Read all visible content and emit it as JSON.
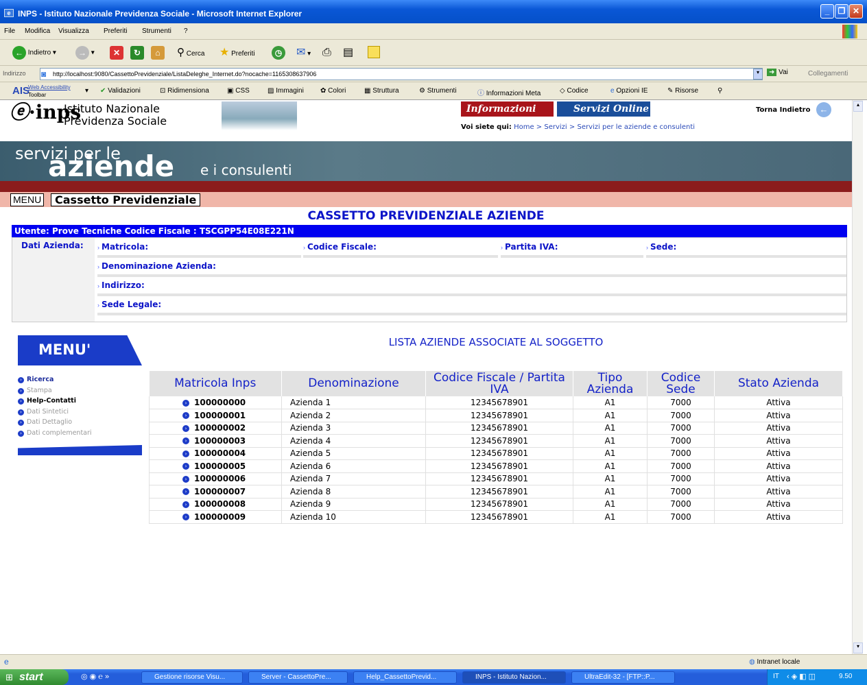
{
  "window": {
    "title": "INPS - Istituto Nazionale Previdenza Sociale - Microsoft Internet Explorer"
  },
  "menubar": [
    "File",
    "Modifica",
    "Visualizza",
    "Preferiti",
    "Strumenti",
    "?"
  ],
  "toolbar": {
    "back": "Indietro",
    "search": "Cerca",
    "favorites": "Preferiti"
  },
  "addressbar": {
    "label": "Indirizzo",
    "url": "http://localhost:9080/CassettoPrevidenziale/ListaDeleghe_Internet.do?nocache=1165308637906",
    "go": "Vai",
    "links": "Collegamenti"
  },
  "aisbar": {
    "logo": "AIS",
    "web_acc": "Web Accessibility",
    "toolbar": "Toolbar",
    "items": [
      "Validazioni",
      "Ridimensiona",
      "CSS",
      "Immagini",
      "Colori",
      "Struttura",
      "Strumenti",
      "Informazioni Meta",
      "Codice",
      "Opzioni IE",
      "Risorse"
    ]
  },
  "header": {
    "logo": "e-inps",
    "org_line1": "Istituto Nazionale",
    "org_line2": "Previdenza Sociale",
    "tab_info": "Informazioni",
    "tab_servizi": "Servizi Online",
    "back": "Torna Indietro",
    "breadcrumb_label": "Voi siete qui:",
    "breadcrumb": [
      "Home",
      ">",
      "Servizi",
      ">",
      "Servizi per le aziende e consulenti"
    ]
  },
  "banner": {
    "line1": "servizi per le",
    "line2": "aziende",
    "line3": "e i consulenti"
  },
  "menuline": {
    "menu": "MENU",
    "section": "Cassetto Previdenziale"
  },
  "main": {
    "title": "CASSETTO PREVIDENZIALE AZIENDE",
    "user": "Utente:  Prove Tecniche    Codice Fiscale :  TSCGPP54E08E221N"
  },
  "dati": {
    "label": "Dati Azienda:",
    "matricola": "Matricola:",
    "cf": "Codice Fiscale:",
    "piva": "Partita IVA:",
    "sede": "Sede:",
    "denominazione": "Denominazione Azienda:",
    "indirizzo": "Indirizzo:",
    "sede_legale": "Sede Legale:"
  },
  "sidemenu": {
    "title": "MENU'",
    "items": [
      {
        "label": "Ricerca",
        "bold": true
      },
      {
        "label": "Stampa",
        "bold": false
      },
      {
        "label": "Help-Contatti",
        "bold": true
      },
      {
        "label": "Dati Sintetici",
        "bold": false
      },
      {
        "label": "Dati Dettaglio",
        "bold": false
      },
      {
        "label": "Dati complementari",
        "bold": false
      }
    ]
  },
  "list": {
    "title": "LISTA AZIENDE ASSOCIATE AL SOGGETTO",
    "headers": [
      "Matricola Inps",
      "Denominazione",
      "Codice Fiscale / Partita IVA",
      "Tipo Azienda",
      "Codice Sede",
      "Stato Azienda"
    ],
    "rows": [
      [
        "100000000",
        "Azienda 1",
        "12345678901",
        "A1",
        "7000",
        "Attiva"
      ],
      [
        "100000001",
        "Azienda 2",
        "12345678901",
        "A1",
        "7000",
        "Attiva"
      ],
      [
        "100000002",
        "Azienda 3",
        "12345678901",
        "A1",
        "7000",
        "Attiva"
      ],
      [
        "100000003",
        "Azienda 4",
        "12345678901",
        "A1",
        "7000",
        "Attiva"
      ],
      [
        "100000004",
        "Azienda 5",
        "12345678901",
        "A1",
        "7000",
        "Attiva"
      ],
      [
        "100000005",
        "Azienda 6",
        "12345678901",
        "A1",
        "7000",
        "Attiva"
      ],
      [
        "100000006",
        "Azienda 7",
        "12345678901",
        "A1",
        "7000",
        "Attiva"
      ],
      [
        "100000007",
        "Azienda 8",
        "12345678901",
        "A1",
        "7000",
        "Attiva"
      ],
      [
        "100000008",
        "Azienda 9",
        "12345678901",
        "A1",
        "7000",
        "Attiva"
      ],
      [
        "100000009",
        "Azienda 10",
        "12345678901",
        "A1",
        "7000",
        "Attiva"
      ]
    ]
  },
  "status": {
    "zone": "Intranet locale"
  },
  "taskbar": {
    "start": "start",
    "tasks": [
      "Gestione risorse Visu...",
      "Server - CassettoPre...",
      "Help_CassettoPrevid...",
      "INPS - Istituto Nazion...",
      "UltraEdit-32 - [FTP::P..."
    ],
    "lang": "IT",
    "clock": "9.50"
  }
}
